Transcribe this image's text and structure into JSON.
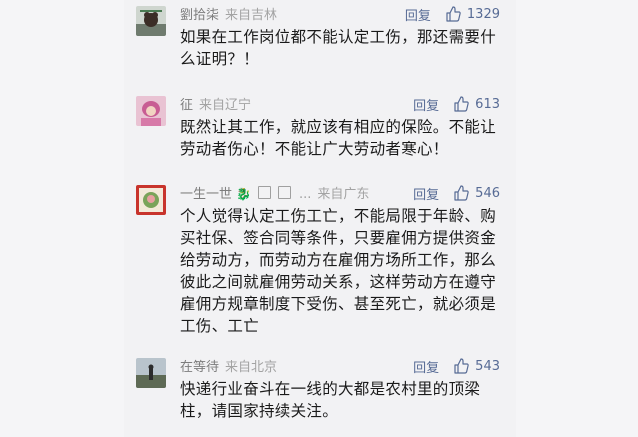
{
  "comments": [
    {
      "name": "劉拾柒",
      "location": "来自吉林",
      "reply_label": "回复",
      "likes": "1329",
      "text_lines": [
        "如果在工作岗位都不能认定工伤，那还需要什",
        "么证明？！"
      ]
    },
    {
      "name": "征",
      "location": "来自辽宁",
      "reply_label": "回复",
      "likes": "613",
      "text_lines": [
        "既然让其工作，就应该有相应的保险。不能让",
        "劳动者伤心！不能让广大劳动者寒心！"
      ]
    },
    {
      "name": "一生一世",
      "name_emoji": "🐉",
      "name_extra": "...",
      "location": "来自广东",
      "reply_label": "回复",
      "likes": "546",
      "text_lines": [
        "个人觉得认定工伤工亡，不能局限于年龄、购",
        "买社保、签合同等条件，只要雇佣方提供资金",
        "给劳动方，而劳动方在雇佣方场所工作，那么",
        "彼此之间就雇佣劳动关系，这样劳动方在遵守",
        "雇佣方规章制度下受伤、甚至死亡，就必须是",
        "工伤、工亡"
      ]
    },
    {
      "name": "在等待",
      "location": "来自北京",
      "reply_label": "回复",
      "likes": "543",
      "text_lines": [
        "快递行业奋斗在一线的大都是农村里的顶梁",
        "柱，请国家持续关注。"
      ]
    }
  ],
  "colors": {
    "link": "#576b95",
    "meta": "#8a8a8a",
    "text": "#1a1a1a",
    "background": "#f2f2f4"
  },
  "icons": {
    "like": "thumbs-up-icon"
  }
}
